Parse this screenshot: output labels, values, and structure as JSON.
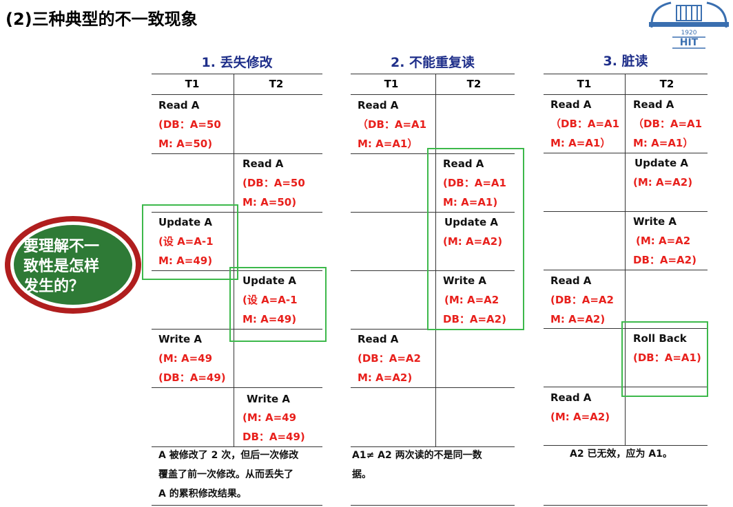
{
  "slide": {
    "title": "(2)三种典型的不一致现象"
  },
  "logo": {
    "year": "1920",
    "letters": "HIT"
  },
  "badge": {
    "lines": [
      "要理解不一",
      "致性是怎样",
      "发生的？"
    ]
  },
  "tables": [
    {
      "title": "1. 丢失修改",
      "headers": [
        "T1",
        "T2"
      ],
      "cells": {
        "r1_t1": [
          "Read A",
          "(DB：A=50",
          "M: A=50)"
        ],
        "r2_t2": [
          "Read A",
          "(DB：A=50",
          "M: A=50)"
        ],
        "r3_t1": [
          "Update A",
          "(设 A=A-1",
          "M: A=49)"
        ],
        "r4_t2": [
          "Update A",
          "(设 A=A-1",
          "M: A=49)"
        ],
        "r5_t1": [
          "Write A",
          "(M: A=49",
          "(DB：A=49)"
        ],
        "r6_t2": [
          "Write A",
          "(M: A=49",
          "DB：A=49)"
        ]
      },
      "note": [
        "A 被修改了 2 次，但后一次修改",
        "覆盖了前一次修改。从而丢失了",
        "A 的累积修改结果。"
      ]
    },
    {
      "title": "2. 不能重复读",
      "headers": [
        "T1",
        "T2"
      ],
      "cells": {
        "r1_t1": [
          "Read A",
          "（DB：A=A1",
          "M: A=A1）"
        ],
        "r2_t2": [
          "Read A",
          "(DB：A=A1",
          "M: A=A1)"
        ],
        "r3_t2": [
          "Update A",
          "(M: A=A2)"
        ],
        "r4_t2": [
          "Write A",
          "(M: A=A2",
          "DB：A=A2)"
        ],
        "r5_t1": [
          "Read A",
          "(DB：A=A2",
          "M: A=A2)"
        ]
      },
      "note": [
        "A1≠ A2 两次读的不是同一数",
        "据。"
      ]
    },
    {
      "title": "3. 脏读",
      "headers": [
        "T1",
        "T2"
      ],
      "cells": {
        "r1_t1": [
          "Read A",
          "（DB：A=A1",
          "M: A=A1）"
        ],
        "r1_t2": [
          "Read A",
          "（DB：A=A1",
          "M: A=A1）"
        ],
        "r2_t2": [
          "Update A",
          "(M: A=A2)"
        ],
        "r3_t2": [
          "Write A",
          "(M: A=A2",
          "DB：A=A2)"
        ],
        "r4_t1": [
          "Read A",
          "(DB：A=A2",
          "M: A=A2)"
        ],
        "r5_t2": [
          "Roll Back",
          "(DB：A=A1)"
        ],
        "r6_t1": [
          "Read A",
          "(M: A=A2)"
        ]
      },
      "note": [
        "A2 已无效，应为 A1。"
      ]
    }
  ]
}
